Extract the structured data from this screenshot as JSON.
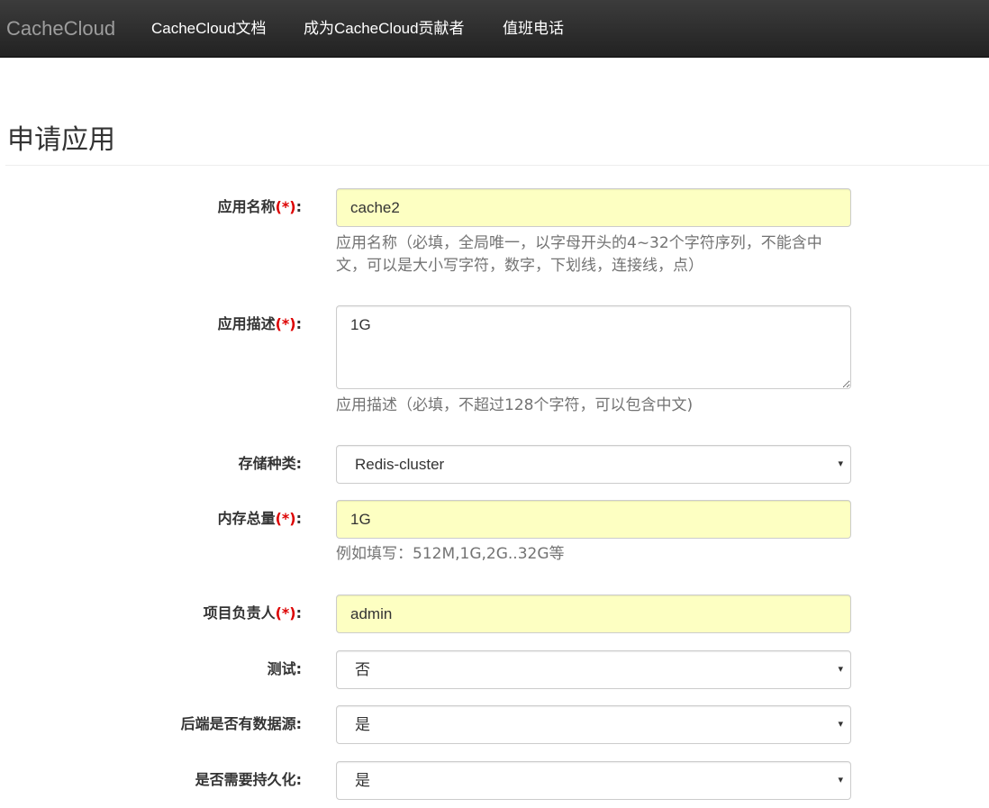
{
  "navbar": {
    "brand": "CacheCloud",
    "links": [
      {
        "label": "CacheCloud文档"
      },
      {
        "label": "成为CacheCloud贡献者"
      },
      {
        "label": "值班电话"
      }
    ],
    "background_color": "#222222"
  },
  "page": {
    "title": "申请应用"
  },
  "colors": {
    "required_marker": "#dd0000",
    "autofill_background": "#fdffc2",
    "help_text": "#737373"
  },
  "form": {
    "app_name": {
      "label": "应用名称",
      "required_marker": "(*)",
      "colon": ":",
      "value": "cache2",
      "help_line1": "应用名称（必填，全局唯一，以字母开头的4~32个字符序列，不能含中",
      "help_line2": "文，可以是大小写字符，数字，下划线，连接线，点）"
    },
    "app_desc": {
      "label": "应用描述",
      "required_marker": "(*)",
      "colon": ":",
      "value": "1G",
      "help": "应用描述（必填，不超过128个字符，可以包含中文)"
    },
    "storage_type": {
      "label": "存储种类:",
      "selected": "Redis-cluster"
    },
    "memory_total": {
      "label": "内存总量",
      "required_marker": "(*)",
      "colon": ":",
      "value": "1G",
      "help": "例如填写：512M,1G,2G..32G等"
    },
    "owner": {
      "label": "项目负责人",
      "required_marker": "(*)",
      "colon": ":",
      "value": "admin"
    },
    "is_test": {
      "label": "测试:",
      "selected": "否"
    },
    "has_backend_source": {
      "label": "后端是否有数据源:",
      "selected": "是"
    },
    "need_persistence": {
      "label": "是否需要持久化:",
      "selected": "是"
    },
    "select_caret": "▾"
  }
}
